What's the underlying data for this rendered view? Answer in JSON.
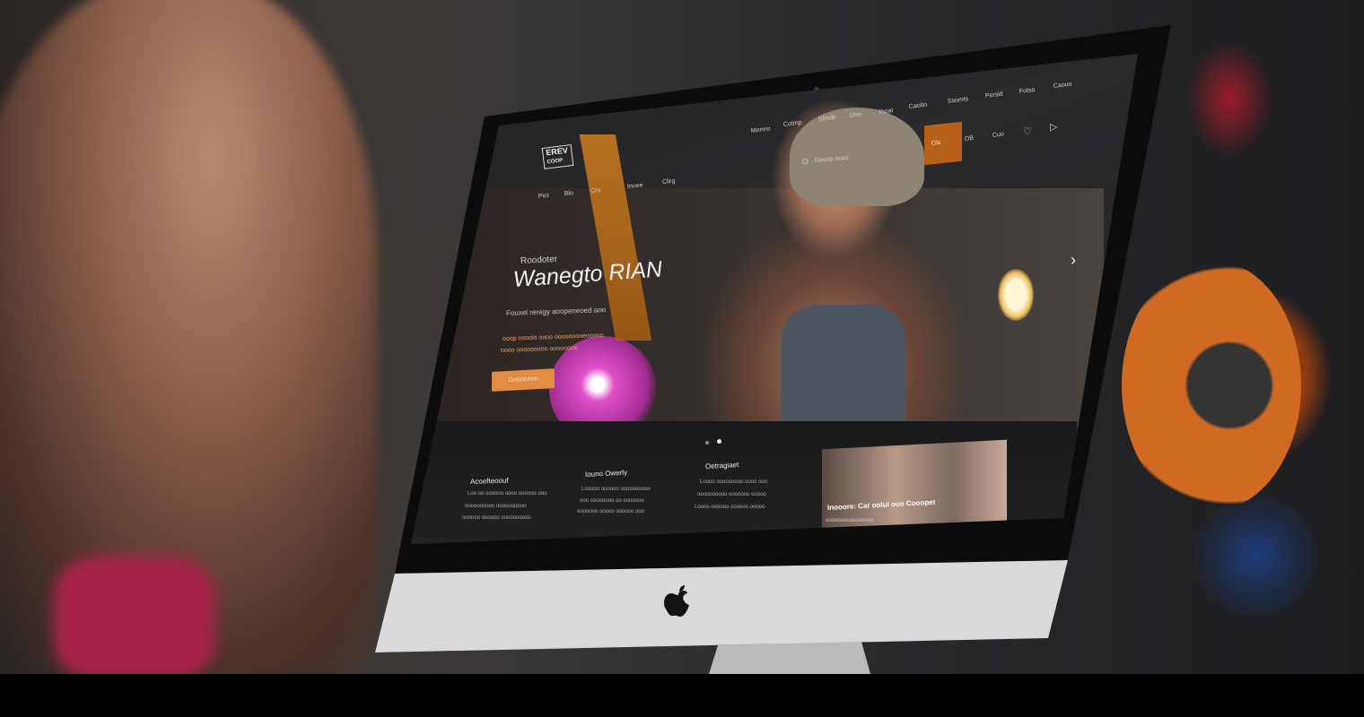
{
  "site": {
    "logo_text": [
      "EREV",
      "COOP"
    ],
    "top_nav": [
      "Menno",
      "Cotmp",
      "Stmdk",
      "Urto",
      "Ihoal",
      "Caotio",
      "Ssomts",
      "Persid",
      "Fotso",
      "Caouo"
    ],
    "sub_nav": [
      "Pict",
      "Blo",
      "Cro",
      "Inoee",
      "Clirg"
    ],
    "icon_tabs": [
      "Ols",
      "OB",
      "Cuo"
    ],
    "search_label": "Dooop ouss",
    "hero": {
      "eyebrow": "Roodoter",
      "title": "Wanegto RIAN",
      "subtitle": "Fouxel reregy aoopeneoed aoo",
      "body_lines": [
        "ooop oooolo oooo ooooooooeooooo",
        "oooo ooooooooo oooooooo"
      ],
      "cta_label": "Gooooooo",
      "next_label": "›"
    },
    "columns": [
      {
        "heading": "Acoefteoouf",
        "lines": [
          "Loo oo oooooo oooo oooooo ooo",
          "oooooooooo oooooooooo",
          "oooooo oooooo oooooooooo"
        ]
      },
      {
        "heading": "Iouno Owerly",
        "lines": [
          "Looooo oooooo oooooooooo",
          "ooo oooooooo oo ooooooo",
          "ooooooo ooooo oooooo ooo"
        ]
      },
      {
        "heading": "Oetragiaet",
        "lines": [
          "Loooo ooooooooo oooo ooo",
          "oooooooooo ooooooo ooooo",
          "Loooo oooooo oooooo ooooo"
        ]
      }
    ],
    "feature_card": {
      "caption": "Inooore: Car oolul ouo Cooopet",
      "subcaption": "oooooooooooooooo"
    },
    "slider_dots": 2,
    "slider_active": 2
  },
  "colors": {
    "accent": "#e28b42",
    "screen_bg": "#1c1c1f",
    "chin": "#d9d9db"
  },
  "icons": [
    "apple-logo-icon",
    "webcam-icon",
    "search-icon",
    "chevron-right-icon"
  ]
}
